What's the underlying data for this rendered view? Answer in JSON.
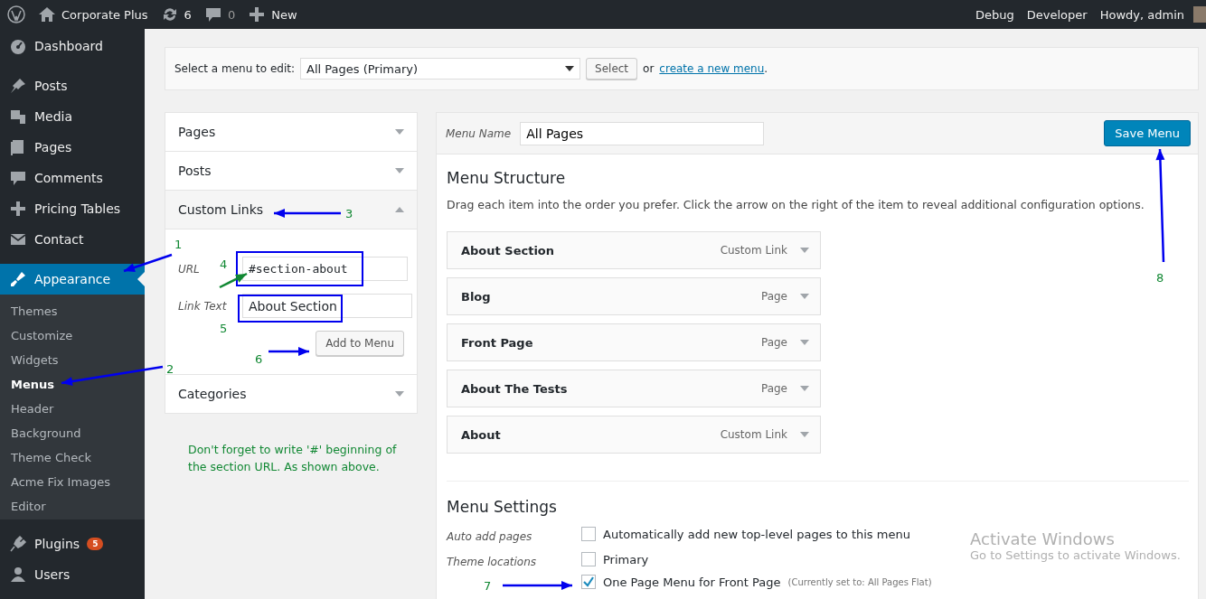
{
  "admin_bar": {
    "site_name": "Corporate Plus",
    "updates_count": "6",
    "comments_count": "0",
    "new_label": "New",
    "right_items": [
      "Debug",
      "Developer",
      "Howdy, admin"
    ]
  },
  "sidebar": {
    "items": [
      {
        "label": "Dashboard",
        "selected": false
      },
      {
        "label": "Posts",
        "selected": false
      },
      {
        "label": "Media",
        "selected": false
      },
      {
        "label": "Pages",
        "selected": false
      },
      {
        "label": "Comments",
        "selected": false
      },
      {
        "label": "Pricing Tables",
        "selected": false
      },
      {
        "label": "Contact",
        "selected": false
      },
      {
        "label": "Appearance",
        "selected": true,
        "children": [
          {
            "label": "Themes",
            "selected": false
          },
          {
            "label": "Customize",
            "selected": false
          },
          {
            "label": "Widgets",
            "selected": false
          },
          {
            "label": "Menus",
            "selected": true
          },
          {
            "label": "Header",
            "selected": false
          },
          {
            "label": "Background",
            "selected": false
          },
          {
            "label": "Theme Check",
            "selected": false
          },
          {
            "label": "Acme Fix Images",
            "selected": false
          },
          {
            "label": "Editor",
            "selected": false
          }
        ]
      },
      {
        "label": "Plugins",
        "selected": false,
        "badge": "5"
      },
      {
        "label": "Users",
        "selected": false
      }
    ]
  },
  "menu_select": {
    "label": "Select a menu to edit:",
    "value": "All Pages (Primary)",
    "button": "Select",
    "or_text": "or",
    "link": "create a new menu",
    "end": "."
  },
  "add_items": {
    "sections": [
      {
        "title": "Pages",
        "expanded": false
      },
      {
        "title": "Posts",
        "expanded": false
      },
      {
        "title": "Custom Links",
        "expanded": true,
        "fields": [
          {
            "label": "URL",
            "value": "#section-about"
          },
          {
            "label": "Link Text",
            "value": "About Section"
          }
        ],
        "button": "Add to Menu"
      },
      {
        "title": "Categories",
        "expanded": false
      }
    ]
  },
  "note": "Don't forget to write '#' beginning of the section URL. As shown above.",
  "menu_editor": {
    "name_label": "Menu Name",
    "name_value": "All Pages",
    "save_button": "Save Menu",
    "structure_title": "Menu Structure",
    "structure_hint": "Drag each item into the order you prefer. Click the arrow on the right of the item to reveal additional configuration options.",
    "items": [
      {
        "title": "About Section",
        "type": "Custom Link"
      },
      {
        "title": "Blog",
        "type": "Page"
      },
      {
        "title": "Front Page",
        "type": "Page"
      },
      {
        "title": "About The Tests",
        "type": "Page"
      },
      {
        "title": "About",
        "type": "Custom Link"
      }
    ],
    "settings_title": "Menu Settings",
    "settings": [
      {
        "label": "Auto add pages",
        "options": [
          {
            "text": "Automatically add new top-level pages to this menu",
            "checked": false
          }
        ]
      },
      {
        "label": "Theme locations",
        "options": [
          {
            "text": "Primary",
            "checked": false
          },
          {
            "text": "One Page Menu for Front Page",
            "note": "(Currently set to: All Pages Flat)",
            "checked": true
          }
        ]
      }
    ]
  },
  "annotations": [
    "1",
    "2",
    "3",
    "4",
    "5",
    "6",
    "7",
    "8"
  ],
  "activation_notice": {
    "title": "Activate Windows",
    "text": "Go to Settings to activate Windows."
  }
}
